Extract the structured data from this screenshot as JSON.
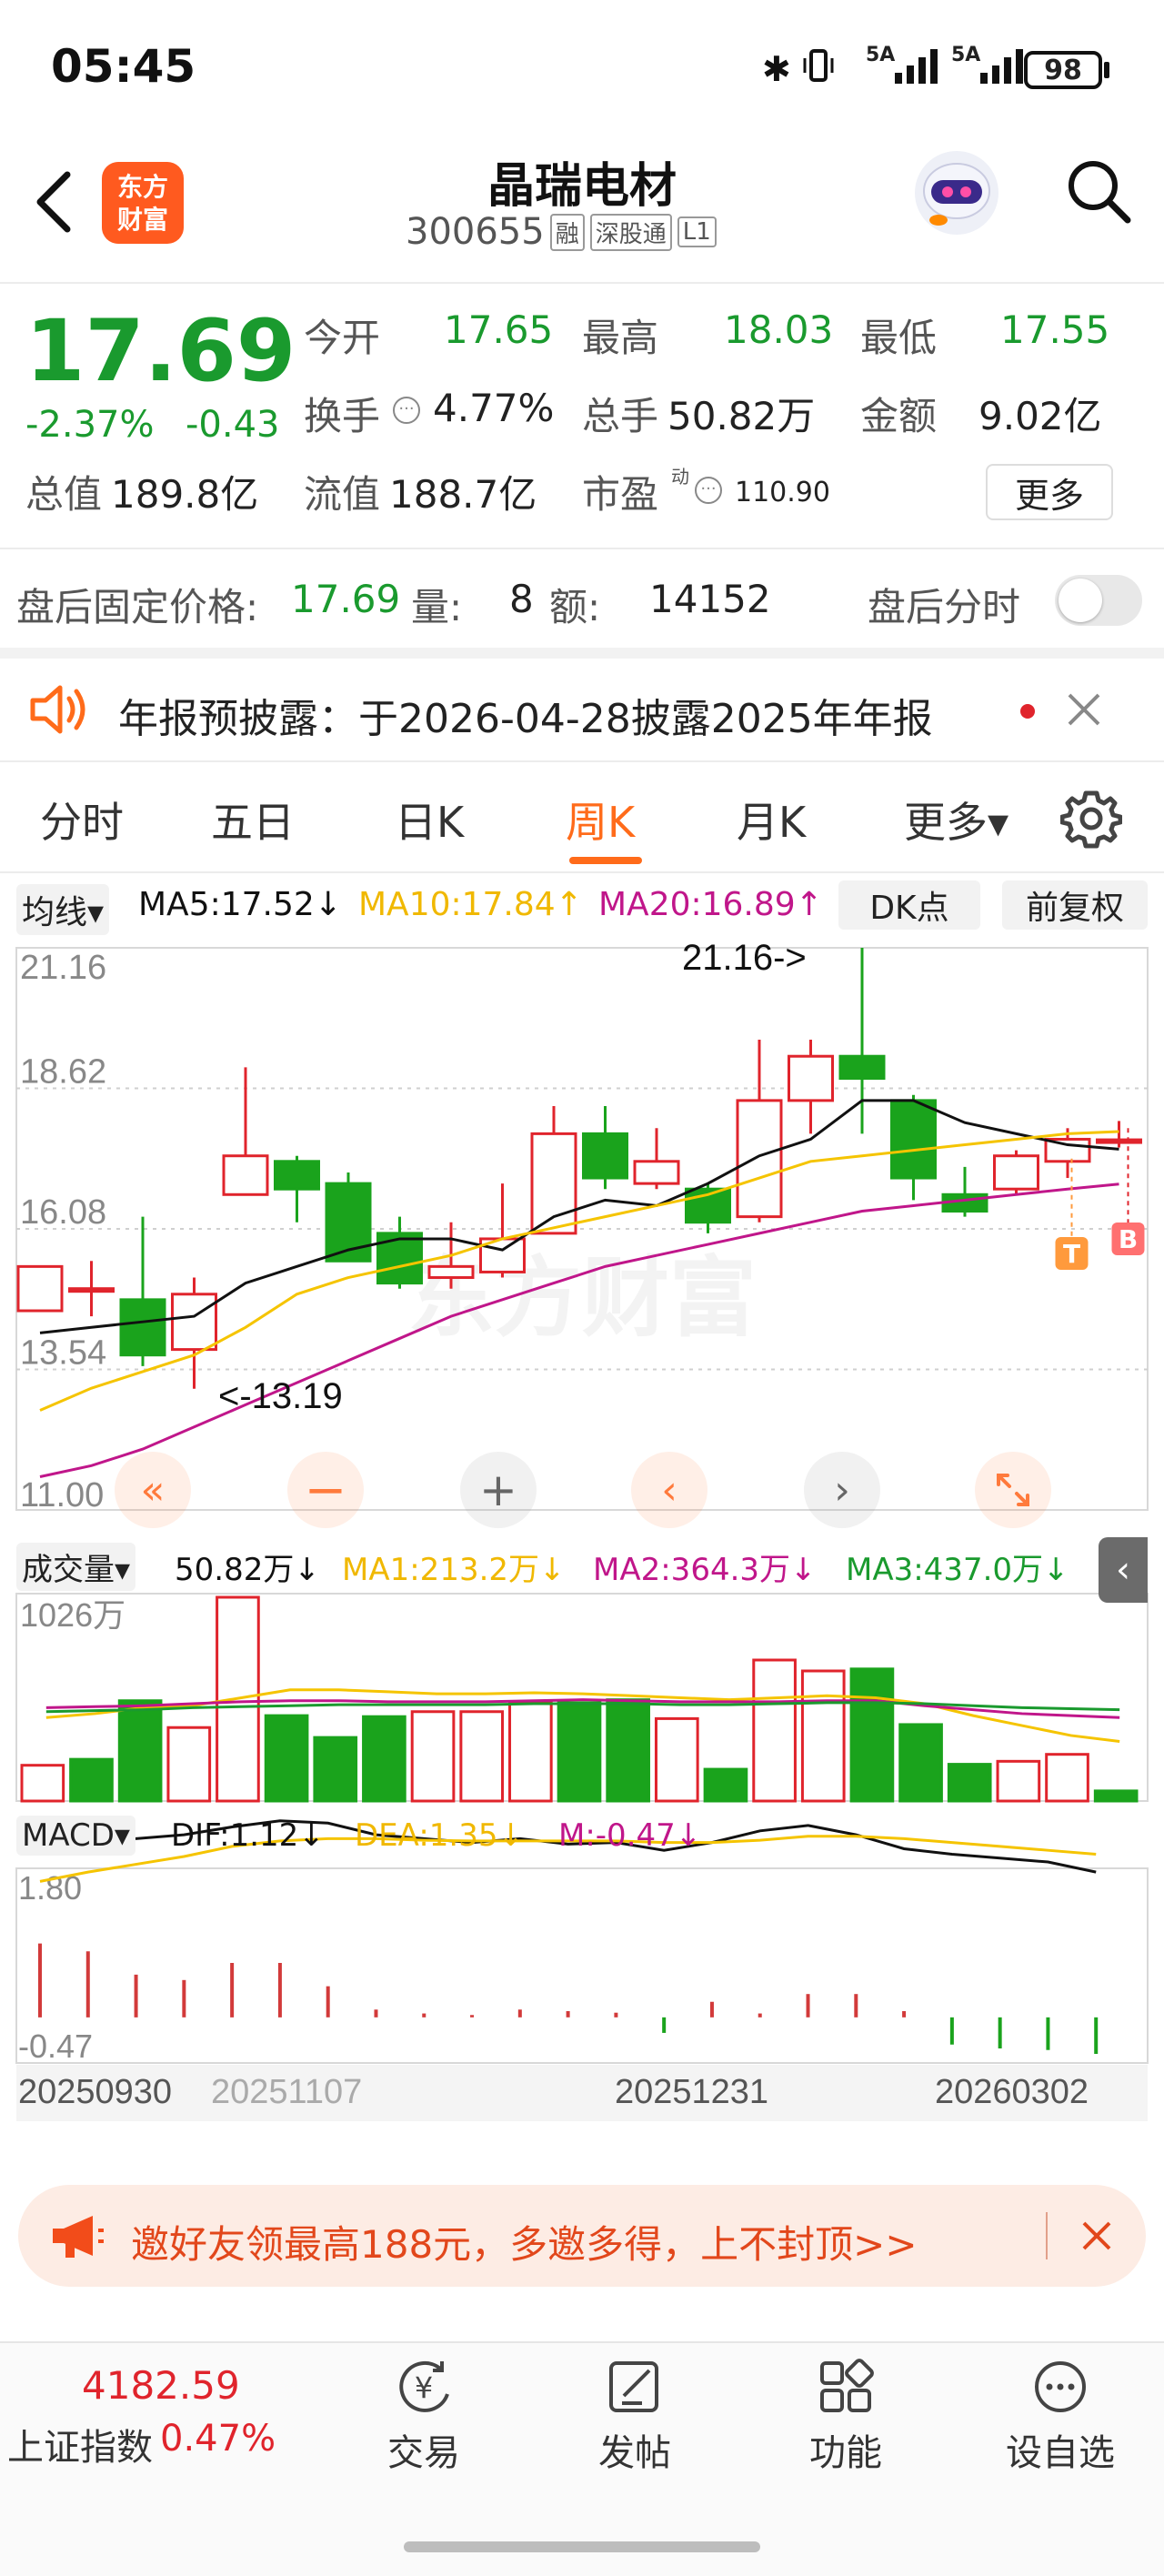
{
  "status_bar": {
    "time": "05:45",
    "net1": "5A",
    "net2": "5A",
    "battery": "98"
  },
  "header": {
    "logo_line1": "东方",
    "logo_line2": "财富",
    "title": "晶瑞电材",
    "code": "300655",
    "tag1": "融",
    "tag2": "深股通",
    "tag3": "L1"
  },
  "quote": {
    "price": "17.69",
    "change_pct": "-2.37%",
    "change": "-0.43",
    "open_label": "今开",
    "open": "17.65",
    "high_label": "最高",
    "high": "18.03",
    "low_label": "最低",
    "low": "17.55",
    "turnover_label": "换手",
    "turnover": "4.77%",
    "volume_label": "总手",
    "volume": "50.82万",
    "amount_label": "金额",
    "amount": "9.02亿",
    "mktcap_label": "总值",
    "mktcap": "189.8亿",
    "float_label": "流值",
    "float": "188.7亿",
    "pe_label": "市盈",
    "pe_sup": "动",
    "pe": "110.90",
    "more_button": "更多"
  },
  "after_hours": {
    "label": "盘后固定价格:",
    "price": "17.69",
    "vol_label": "量:",
    "vol": "8",
    "amt_label": "额:",
    "amt": "14152",
    "toggle_label": "盘后分时",
    "toggle_on": false
  },
  "notice": {
    "text": "年报预披露：于2026-04-28披露2025年年报"
  },
  "tabs": [
    {
      "label": "分时",
      "active": false
    },
    {
      "label": "五日",
      "active": false
    },
    {
      "label": "日K",
      "active": false
    },
    {
      "label": "周K",
      "active": true
    },
    {
      "label": "月K",
      "active": false
    },
    {
      "label": "更多▾",
      "active": false
    }
  ],
  "indicators": {
    "ma_select": "均线▾",
    "ma5": "MA5:17.52↓",
    "ma10": "MA10:17.84↑",
    "ma20": "MA20:16.89↑",
    "dk_button": "DK点",
    "adjust_button": "前复权"
  },
  "colors": {
    "up": "#e0242c",
    "down": "#1aa31c",
    "ma5": "#111111",
    "ma10": "#f5c400",
    "ma20": "#c0168a",
    "accent": "#ff6b1a"
  },
  "chart_data": [
    {
      "type": "candlestick",
      "title": "周K",
      "ylim": [
        11.0,
        21.16
      ],
      "y_ticks": [
        "21.16",
        "18.62",
        "16.08",
        "13.54",
        "11.00"
      ],
      "annotations": [
        "21.16->",
        "<-13.19"
      ],
      "markers": [
        "T",
        "B"
      ],
      "watermark": "东方财富",
      "candles": [
        {
          "o": 14.6,
          "c": 15.4,
          "h": 15.4,
          "l": 14.6
        },
        {
          "o": 15.0,
          "c": 15.0,
          "h": 15.5,
          "l": 14.5
        },
        {
          "o": 14.8,
          "c": 13.8,
          "h": 16.3,
          "l": 13.6
        },
        {
          "o": 13.9,
          "c": 14.9,
          "h": 15.2,
          "l": 13.19
        },
        {
          "o": 16.7,
          "c": 17.4,
          "h": 19.0,
          "l": 16.7
        },
        {
          "o": 17.3,
          "c": 16.8,
          "h": 17.4,
          "l": 16.2
        },
        {
          "o": 16.9,
          "c": 15.5,
          "h": 17.1,
          "l": 15.5
        },
        {
          "o": 16.0,
          "c": 15.1,
          "h": 16.3,
          "l": 15.0
        },
        {
          "o": 15.2,
          "c": 15.4,
          "h": 16.2,
          "l": 15.0
        },
        {
          "o": 15.3,
          "c": 15.9,
          "h": 16.9,
          "l": 15.2
        },
        {
          "o": 16.0,
          "c": 17.8,
          "h": 18.3,
          "l": 16.0
        },
        {
          "o": 17.8,
          "c": 17.0,
          "h": 18.3,
          "l": 16.8
        },
        {
          "o": 16.9,
          "c": 17.3,
          "h": 17.9,
          "l": 16.8
        },
        {
          "o": 16.8,
          "c": 16.2,
          "h": 16.9,
          "l": 16.0
        },
        {
          "o": 16.3,
          "c": 18.4,
          "h": 19.5,
          "l": 16.2
        },
        {
          "o": 18.4,
          "c": 19.2,
          "h": 19.5,
          "l": 17.8
        },
        {
          "o": 19.2,
          "c": 18.8,
          "h": 21.16,
          "l": 17.8
        },
        {
          "o": 18.4,
          "c": 17.0,
          "h": 18.5,
          "l": 16.6
        },
        {
          "o": 16.7,
          "c": 16.4,
          "h": 17.2,
          "l": 16.3
        },
        {
          "o": 16.8,
          "c": 17.4,
          "h": 17.5,
          "l": 16.7
        },
        {
          "o": 17.3,
          "c": 17.7,
          "h": 17.9,
          "l": 17.0
        },
        {
          "o": 17.65,
          "c": 17.69,
          "h": 18.03,
          "l": 17.55
        }
      ],
      "series": [
        {
          "name": "MA5",
          "values": [
            14.2,
            14.3,
            14.4,
            14.5,
            15.1,
            15.4,
            15.7,
            15.9,
            15.9,
            15.7,
            16.3,
            16.6,
            16.5,
            16.9,
            17.4,
            17.7,
            18.4,
            18.4,
            18.0,
            17.8,
            17.6,
            17.52
          ]
        },
        {
          "name": "MA10",
          "values": [
            12.8,
            13.2,
            13.5,
            13.8,
            14.3,
            14.9,
            15.2,
            15.4,
            15.6,
            15.9,
            16.1,
            16.3,
            16.5,
            16.7,
            17.0,
            17.3,
            17.4,
            17.5,
            17.6,
            17.7,
            17.8,
            17.84
          ]
        },
        {
          "name": "MA20",
          "values": [
            11.6,
            11.8,
            12.1,
            12.5,
            12.9,
            13.3,
            13.7,
            14.1,
            14.5,
            14.8,
            15.1,
            15.4,
            15.6,
            15.8,
            16.0,
            16.2,
            16.4,
            16.5,
            16.6,
            16.7,
            16.8,
            16.89
          ]
        }
      ]
    },
    {
      "type": "bar",
      "title": "成交量",
      "ylim": [
        0,
        1026
      ],
      "y_ticks": [
        "1026万"
      ],
      "values": [
        180,
        210,
        505,
        370,
        1026,
        430,
        320,
        425,
        450,
        450,
        500,
        495,
        510,
        415,
        160,
        710,
        655,
        665,
        385,
        185,
        200,
        235,
        50.82
      ],
      "up": [
        true,
        false,
        false,
        true,
        true,
        false,
        false,
        false,
        true,
        true,
        true,
        false,
        false,
        true,
        false,
        true,
        true,
        false,
        false,
        false,
        true,
        true,
        false
      ],
      "select": "成交量▾",
      "vol": "50.82万↓",
      "series": [
        {
          "name": "MA1",
          "label": "MA1:213.2万↓"
        },
        {
          "name": "MA2",
          "label": "MA2:364.3万↓"
        },
        {
          "name": "MA3",
          "label": "MA3:437.0万↓"
        }
      ]
    },
    {
      "type": "bar",
      "title": "MACD",
      "ylim": [
        -0.47,
        1.8
      ],
      "y_ticks": [
        "1.80",
        "-0.47"
      ],
      "values": [
        0.95,
        0.85,
        0.55,
        0.48,
        0.7,
        0.7,
        0.4,
        0.1,
        0.05,
        0.03,
        0.1,
        0.08,
        0.06,
        -0.2,
        0.2,
        0.05,
        0.3,
        0.3,
        0.08,
        -0.35,
        -0.4,
        -0.42,
        -0.47
      ],
      "select": "MACD▾",
      "series": [
        {
          "name": "DIF",
          "label": "DIF:1.12↓",
          "values": [
            1.7,
            1.6,
            1.55,
            1.6,
            1.7,
            1.78,
            1.75,
            1.6,
            1.55,
            1.5,
            1.55,
            1.48,
            1.5,
            1.4,
            1.5,
            1.65,
            1.72,
            1.6,
            1.42,
            1.35,
            1.3,
            1.25,
            1.12
          ]
        },
        {
          "name": "DEA",
          "label": "DEA:1.35↓",
          "values": [
            1.0,
            1.12,
            1.22,
            1.32,
            1.45,
            1.52,
            1.55,
            1.55,
            1.53,
            1.52,
            1.52,
            1.52,
            1.52,
            1.5,
            1.5,
            1.53,
            1.58,
            1.58,
            1.55,
            1.5,
            1.45,
            1.4,
            1.35
          ]
        },
        {
          "name": "M",
          "label": "M:-0.47↓"
        }
      ],
      "dates": [
        "20250930",
        "20251107",
        "20251231",
        "20260302"
      ]
    }
  ],
  "promo": {
    "text": "邀好友领最高188元，多邀多得，上不封顶>>"
  },
  "bottom_bar": {
    "index_value": "4182.59",
    "index_name": "上证指数",
    "index_change": "0.47%",
    "items": [
      {
        "label": "交易",
        "icon": "yen-icon"
      },
      {
        "label": "发帖",
        "icon": "edit-icon"
      },
      {
        "label": "功能",
        "icon": "grid-icon"
      },
      {
        "label": "设自选",
        "icon": "more-icon"
      }
    ]
  }
}
